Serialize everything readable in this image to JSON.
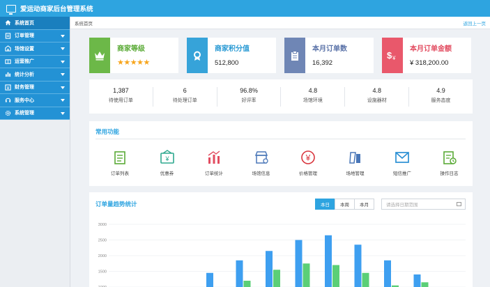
{
  "app": {
    "title": "爱运动商家后台管理系统"
  },
  "sidebar": {
    "items": [
      {
        "label": "系统首页",
        "icon": "home-icon",
        "active": true
      },
      {
        "label": "订单管理",
        "icon": "order-icon"
      },
      {
        "label": "场馆设置",
        "icon": "venue-icon"
      },
      {
        "label": "运营推广",
        "icon": "promo-icon"
      },
      {
        "label": "统计分析",
        "icon": "stats-icon"
      },
      {
        "label": "财务管理",
        "icon": "finance-icon"
      },
      {
        "label": "服务中心",
        "icon": "service-icon"
      },
      {
        "label": "系统管理",
        "icon": "settings-icon"
      }
    ]
  },
  "breadcrumb": {
    "current": "系统首页",
    "back_label": "返回上一页"
  },
  "stats": [
    {
      "label": "商家等级",
      "value": "★★★★★",
      "color": "#6cb848",
      "label_color": "#5aaa36",
      "icon": "crown-icon"
    },
    {
      "label": "商家积分值",
      "value": "512,800",
      "color": "#36a3d9",
      "label_color": "#2a9ad4",
      "icon": "badge-icon"
    },
    {
      "label": "本月订单数",
      "value": "16,392",
      "color": "#6f86b5",
      "label_color": "#5a72a8",
      "icon": "clipboard-icon"
    },
    {
      "label": "本月订单金额",
      "value": "¥ 318,200.00",
      "color": "#e9586b",
      "label_color": "#e24c60",
      "icon": "money-icon"
    }
  ],
  "metrics": [
    {
      "value": "1,387",
      "label": "待使用订单"
    },
    {
      "value": "6",
      "label": "待处理订单"
    },
    {
      "value": "96.8%",
      "label": "好评率"
    },
    {
      "value": "4.8",
      "label": "场馆环境"
    },
    {
      "value": "4.8",
      "label": "设施器材"
    },
    {
      "value": "4.9",
      "label": "服务态度"
    }
  ],
  "functions": {
    "title": "常用功能",
    "items": [
      {
        "label": "订单列表",
        "icon": "list-icon",
        "color": "#5aaa36"
      },
      {
        "label": "优惠券",
        "icon": "coupon-icon",
        "color": "#2ea98f"
      },
      {
        "label": "订单统计",
        "icon": "bar-stats-icon",
        "color": "#e24c60"
      },
      {
        "label": "场馆信息",
        "icon": "store-icon",
        "color": "#4a77b8"
      },
      {
        "label": "价格管理",
        "icon": "yen-icon",
        "color": "#d9363e"
      },
      {
        "label": "场地管理",
        "icon": "field-icon",
        "color": "#4a77b8"
      },
      {
        "label": "短信推广",
        "icon": "mail-icon",
        "color": "#2a8fd4"
      },
      {
        "label": "操作日志",
        "icon": "log-icon",
        "color": "#5aaa36"
      }
    ]
  },
  "order_chart": {
    "title": "订单量趋势统计",
    "tabs": [
      "本日",
      "本周",
      "本月"
    ],
    "active_tab": "本日",
    "date_placeholder": "请选择日期范围"
  },
  "chart_data": {
    "type": "bar",
    "y_ticks": [
      "3000",
      "2500",
      "2000",
      "1500",
      "1000"
    ],
    "ylim": [
      1000,
      3000
    ],
    "series": [
      {
        "color": "#3e9ff0",
        "values": [
          1450,
          1850,
          2150,
          2500,
          2650,
          2350,
          1850,
          1400
        ]
      },
      {
        "color": "#5bcf77",
        "values": [
          null,
          1200,
          1550,
          1750,
          1700,
          1450,
          1050,
          1150
        ]
      }
    ]
  }
}
